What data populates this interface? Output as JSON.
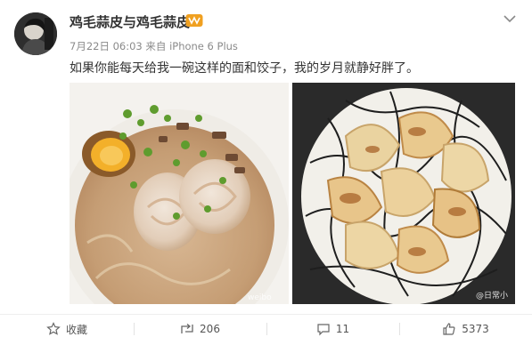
{
  "post": {
    "username": "鸡毛蒜皮与鸡毛蒜皮",
    "date": "7月22日 06:03",
    "source_prefix": "来自",
    "device": "iPhone 6 Plus",
    "text": "如果你能每天给我一碗这样的面和饺子，我的岁月就静好胖了。",
    "images": [
      {
        "subject": "ramen bowl with egg and pork"
      },
      {
        "subject": "pan-fried dumplings on patterned plate"
      }
    ],
    "watermark": "@日常小"
  },
  "actions": {
    "favorite_label": "收藏",
    "repost_count": "206",
    "comment_count": "11",
    "like_count": "5373"
  },
  "icons": [
    "avatar",
    "vip-badge-icon",
    "chevron-down-icon",
    "star-icon",
    "repost-icon",
    "comment-icon",
    "thumbs-up-icon"
  ],
  "colors": {
    "text": "#333333",
    "meta": "#8a8a8a",
    "vip_badge": "#f0a020"
  }
}
